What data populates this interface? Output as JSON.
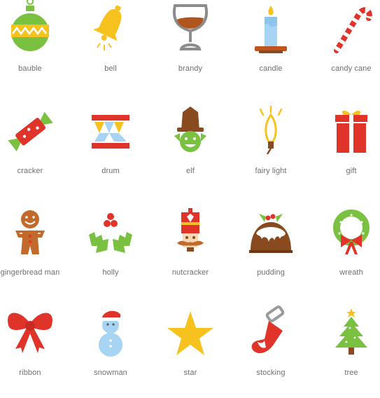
{
  "icons": [
    {
      "label": "bauble",
      "icon": "bauble-icon"
    },
    {
      "label": "bell",
      "icon": "bell-icon"
    },
    {
      "label": "brandy",
      "icon": "brandy-icon"
    },
    {
      "label": "candle",
      "icon": "candle-icon"
    },
    {
      "label": "candy cane",
      "icon": "candy-cane-icon"
    },
    {
      "label": "cracker",
      "icon": "cracker-icon"
    },
    {
      "label": "drum",
      "icon": "drum-icon"
    },
    {
      "label": "elf",
      "icon": "elf-icon"
    },
    {
      "label": "fairy light",
      "icon": "fairy-light-icon"
    },
    {
      "label": "gift",
      "icon": "gift-icon"
    },
    {
      "label": "gingerbread man",
      "icon": "gingerbread-man-icon"
    },
    {
      "label": "holly",
      "icon": "holly-icon"
    },
    {
      "label": "nutcracker",
      "icon": "nutcracker-icon"
    },
    {
      "label": "pudding",
      "icon": "pudding-icon"
    },
    {
      "label": "wreath",
      "icon": "wreath-icon"
    },
    {
      "label": "ribbon",
      "icon": "ribbon-icon"
    },
    {
      "label": "snowman",
      "icon": "snowman-icon"
    },
    {
      "label": "star",
      "icon": "star-icon"
    },
    {
      "label": "stocking",
      "icon": "stocking-icon"
    },
    {
      "label": "tree",
      "icon": "tree-icon"
    }
  ],
  "colors": {
    "red": "#e0342a",
    "green": "#7ac142",
    "yellow": "#f7c21e",
    "brown": "#8a4a1f",
    "blue": "#a6d4f2",
    "label": "#6f6f6f"
  }
}
